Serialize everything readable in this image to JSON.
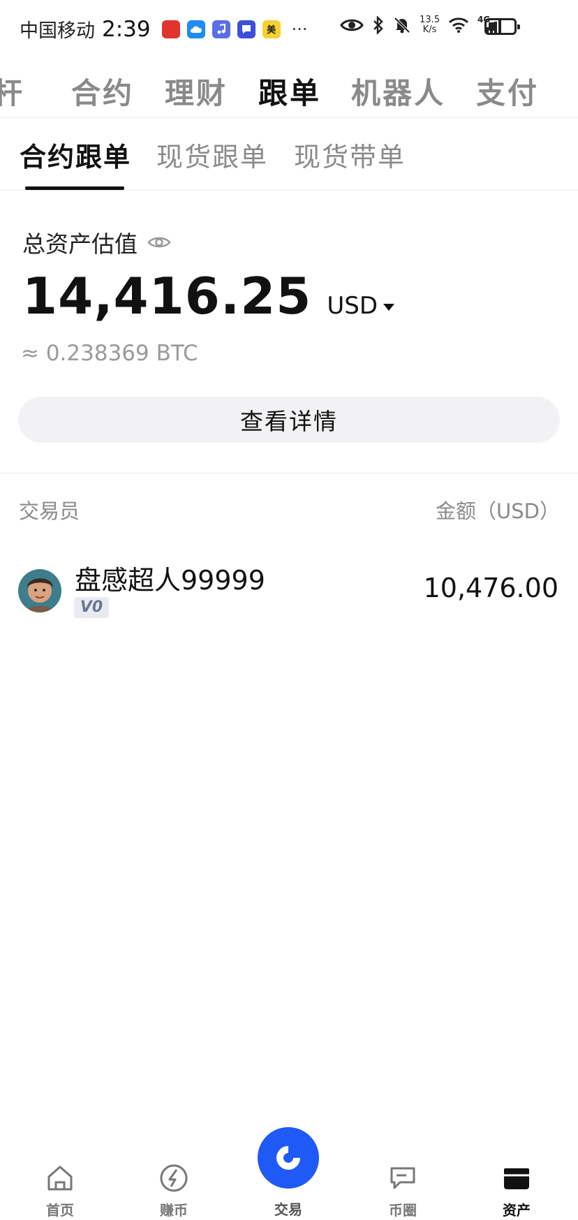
{
  "status_bar": {
    "carrier": "中国移动",
    "time": "2:39",
    "notification_app_badge": "美",
    "more": "···",
    "net_speed": "13.5",
    "net_speed_unit": "K/s",
    "signal": "4G"
  },
  "top_tabs": [
    "杆",
    "合约",
    "理财",
    "跟单",
    "机器人",
    "支付"
  ],
  "top_tab_active": "跟单",
  "sub_tabs": [
    "合约跟单",
    "现货跟单",
    "现货带单"
  ],
  "sub_tab_active": "合约跟单",
  "asset": {
    "label": "总资产估值",
    "value": "14,416.25",
    "currency": "USD",
    "btc_equivalent": "≈ 0.238369 BTC",
    "details_button": "查看详情"
  },
  "table": {
    "col_trader": "交易员",
    "col_amount": "金额（USD）",
    "rows": [
      {
        "name": "盘感超人99999",
        "level": "V0",
        "amount": "10,476.00"
      }
    ]
  },
  "bottom_nav": {
    "items": [
      "首页",
      "赚币",
      "交易",
      "币圈",
      "资产"
    ],
    "active": "资产"
  },
  "colors": {
    "accent": "#1f5af6",
    "text_primary": "#111111",
    "text_secondary": "#8a8a8a"
  }
}
